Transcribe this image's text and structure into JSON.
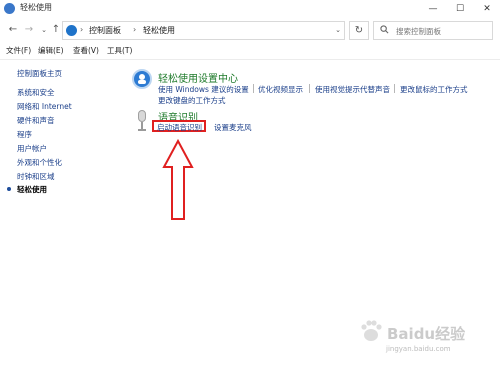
{
  "window": {
    "title": "轻松使用",
    "minimize": "—",
    "maximize": "☐",
    "close": "✕"
  },
  "address": {
    "back": "←",
    "forward": "→",
    "dropdown": "⌄",
    "up": "↑",
    "breadcrumbs": [
      "控制面板",
      "轻松使用"
    ],
    "separator": "›",
    "refresh": "↻",
    "search_placeholder": "搜索控制面板"
  },
  "menu": {
    "file": "文件(F)",
    "edit": "编辑(E)",
    "view": "查看(V)",
    "tools": "工具(T)"
  },
  "sidebar": {
    "home": "控制面板主页",
    "items": [
      {
        "label": "系统和安全"
      },
      {
        "label": "网络和 Internet"
      },
      {
        "label": "硬件和声音"
      },
      {
        "label": "程序"
      },
      {
        "label": "用户帐户"
      },
      {
        "label": "外观和个性化"
      },
      {
        "label": "时钟和区域"
      },
      {
        "label": "轻松使用"
      }
    ],
    "current_index": 7
  },
  "ease_center": {
    "heading": "轻松使用设置中心",
    "links": [
      "使用 Windows 建议的设置",
      "优化视频显示",
      "使用视觉提示代替声音",
      "更改鼠标的工作方式",
      "更改键盘的工作方式"
    ]
  },
  "speech": {
    "heading": "语音识别",
    "links": [
      "启动语音识别",
      "设置麦克风"
    ]
  },
  "annotation": {
    "highlight_color": "#e02020"
  },
  "watermark": {
    "text": "Baidu经验",
    "sub": "jingyan.baidu.com"
  },
  "colors": {
    "link": "#1b3f8a",
    "heading_green": "#1e7a2a",
    "icon_blue": "#2d7bd3"
  }
}
